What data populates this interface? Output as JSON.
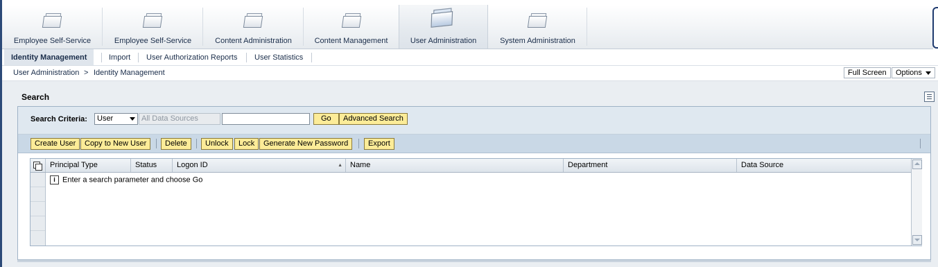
{
  "top_tabs": [
    {
      "label": "Employee Self-Service",
      "active": false
    },
    {
      "label": "Employee Self-Service",
      "active": false
    },
    {
      "label": "Content Administration",
      "active": false
    },
    {
      "label": "Content Management",
      "active": false
    },
    {
      "label": "User Administration",
      "active": true
    },
    {
      "label": "System Administration",
      "active": false
    }
  ],
  "sub_tabs": [
    {
      "label": "Identity Management",
      "active": true
    },
    {
      "label": "Import",
      "active": false
    },
    {
      "label": "User Authorization Reports",
      "active": false
    },
    {
      "label": "User Statistics",
      "active": false
    }
  ],
  "breadcrumb": {
    "items": [
      "User Administration",
      "Identity Management"
    ],
    "separator": ">"
  },
  "page_actions": {
    "full_screen": "Full Screen",
    "options": "Options"
  },
  "search": {
    "title": "Search",
    "criteria_label": "Search Criteria:",
    "criteria_value": "User",
    "data_source_placeholder": "All Data Sources",
    "query_value": "",
    "go_label": "Go",
    "advanced_label": "Advanced Search"
  },
  "toolbar": {
    "create_user": "Create User",
    "copy_user": "Copy to New User",
    "delete": "Delete",
    "unlock": "Unlock",
    "lock": "Lock",
    "generate_password": "Generate New Password",
    "export": "Export"
  },
  "table": {
    "columns": [
      "Principal Type",
      "Status",
      "Logon ID",
      "Name",
      "Department",
      "Data Source"
    ],
    "sort_indicator": "▲",
    "empty_message": "Enter a search parameter and choose Go",
    "info_icon": "i"
  },
  "colors": {
    "button_yellow": "#fcec98",
    "toolbar_blue": "#c9d8e6",
    "nav_text": "#1a2d4a"
  }
}
